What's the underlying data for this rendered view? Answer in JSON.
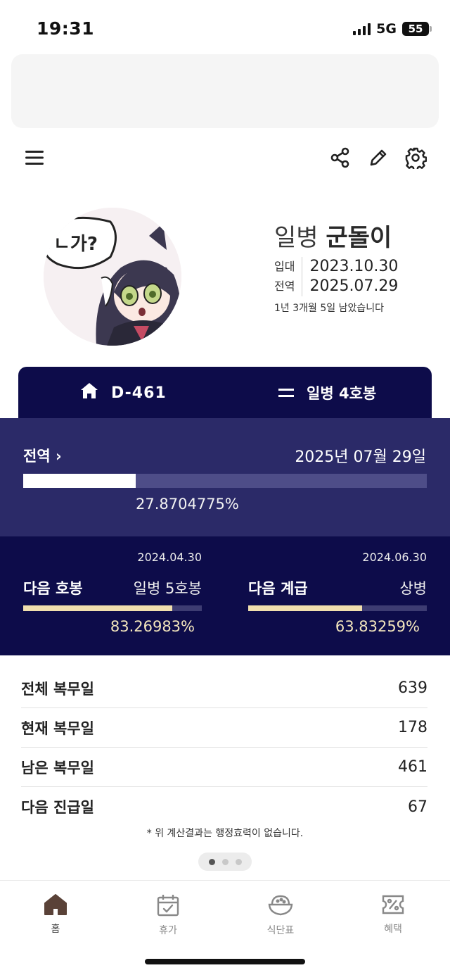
{
  "status": {
    "time": "19:31",
    "network": "5G",
    "battery": "55"
  },
  "toolbar": {
    "menu_icon": "hamburger-menu-icon",
    "share_icon": "share-icon",
    "edit_icon": "pencil-icon",
    "settings_icon": "gear-icon"
  },
  "profile": {
    "rank": "일병",
    "name": "군돌이",
    "enlist_label": "입대",
    "enlist_date": "2023.10.30",
    "discharge_label": "전역",
    "discharge_date": "2025.07.29",
    "remaining_text": "1년 3개월 5일 남았습니다"
  },
  "dday": {
    "label": "D-461",
    "grade": "일병 4호봉"
  },
  "discharge": {
    "title": "전역 ›",
    "date": "2025년 07월 29일",
    "percent": "27.8704775%",
    "progress": 0.278704775
  },
  "next_step": {
    "title": "다음 호봉",
    "date": "2024.04.30",
    "rank": "일병 5호봉",
    "percent": "83.26983%",
    "progress": 0.8326983
  },
  "next_rank": {
    "title": "다음 계급",
    "date": "2024.06.30",
    "rank": "상병",
    "percent": "63.83259%",
    "progress": 0.6383259
  },
  "stats": [
    {
      "label": "전체 복무일",
      "value": "639"
    },
    {
      "label": "현재 복무일",
      "value": "178"
    },
    {
      "label": "남은 복무일",
      "value": "461"
    },
    {
      "label": "다음 진급일",
      "value": "67"
    }
  ],
  "note": "* 위 계산결과는 행정효력이 없습니다.",
  "nav": [
    {
      "label": "홈",
      "icon": "home-icon"
    },
    {
      "label": "휴가",
      "icon": "calendar-check-icon"
    },
    {
      "label": "식단표",
      "icon": "rice-bowl-icon"
    },
    {
      "label": "혜택",
      "icon": "coupon-icon"
    }
  ],
  "colors": {
    "navy": "#0d0c4a",
    "panel": "#2b2a68",
    "gold": "#f0dfae"
  }
}
